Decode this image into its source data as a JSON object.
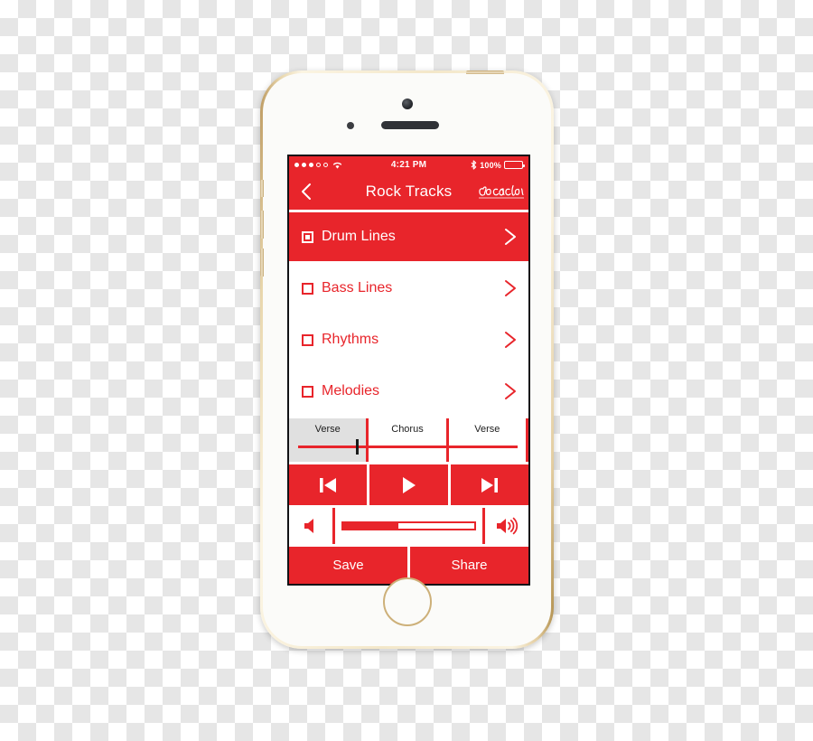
{
  "device": {
    "name": "iPhone 5s Gold/White",
    "camera_icon": "front-camera",
    "speaker_icon": "earpiece-speaker",
    "home_button_label": "Home"
  },
  "status_bar": {
    "signal_icon": "signal-dots",
    "signal_bars_filled": 3,
    "signal_bars_total": 5,
    "wifi_icon": "wifi-icon",
    "time": "4:21 PM",
    "bluetooth_icon": "bluetooth-icon",
    "battery_percent": "100%",
    "battery_icon": "battery-full-icon",
    "battery_level": 100
  },
  "nav": {
    "back_icon": "back-chevron-icon",
    "title": "Rock Tracks",
    "brand_logo": "coca-cola-logo",
    "brand_name": "Coca-Cola"
  },
  "tracks": [
    {
      "label": "Drum Lines",
      "selected": true,
      "chevron_icon": "chevron-right-icon"
    },
    {
      "label": "Bass Lines",
      "selected": false,
      "chevron_icon": "chevron-right-icon"
    },
    {
      "label": "Rhythms",
      "selected": false,
      "chevron_icon": "chevron-right-icon"
    },
    {
      "label": "Melodies",
      "selected": false,
      "chevron_icon": "chevron-right-icon"
    }
  ],
  "timeline": {
    "segments": [
      {
        "label": "Verse",
        "active": true
      },
      {
        "label": "Chorus",
        "active": false
      },
      {
        "label": "Verse",
        "active": false
      }
    ],
    "playhead_percent": 28
  },
  "transport": [
    {
      "label": "Previous",
      "icon": "skip-previous-icon"
    },
    {
      "label": "Play",
      "icon": "play-icon"
    },
    {
      "label": "Next",
      "icon": "skip-next-icon"
    }
  ],
  "volume": {
    "low_icon": "volume-low-icon",
    "high_icon": "volume-high-icon",
    "level_percent": 42
  },
  "actions": [
    {
      "label": "Save"
    },
    {
      "label": "Share"
    }
  ],
  "colors": {
    "brand_red": "#E8252B",
    "white": "#FFFFFF",
    "segment_active": "#E0E0E0",
    "playhead": "#1A1A1A",
    "gold": "#CDB079"
  }
}
